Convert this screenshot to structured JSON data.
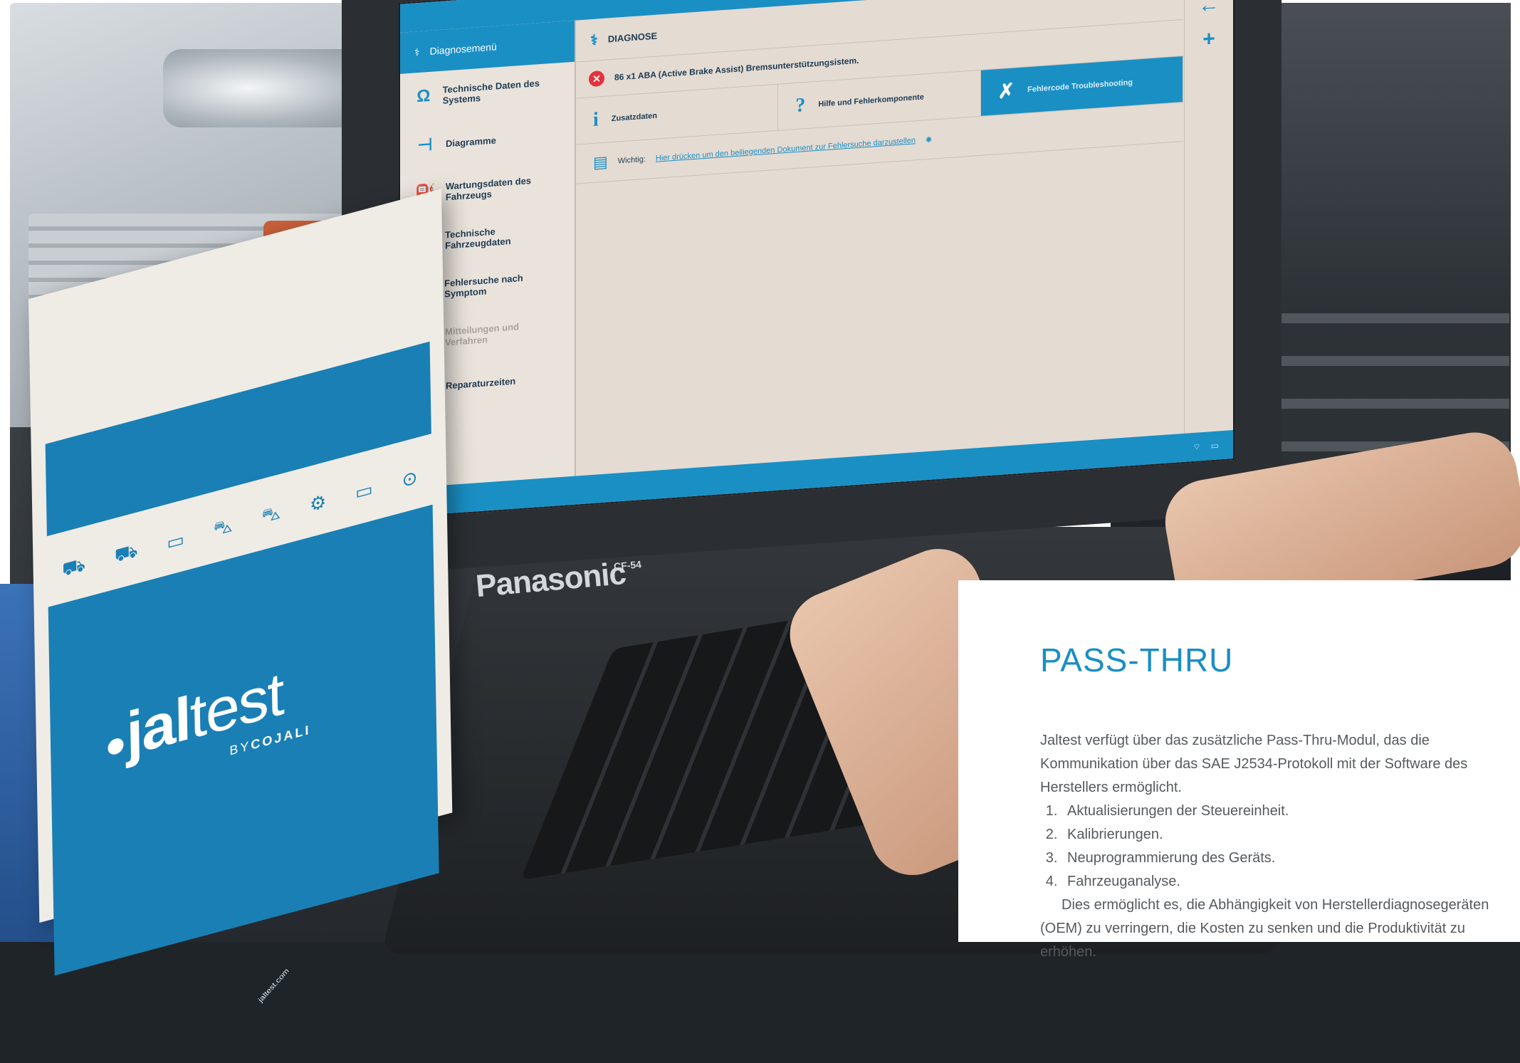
{
  "screen": {
    "menu_header": "Diagnosemenü",
    "menu_items": [
      {
        "label": "Technische Daten des Systems",
        "icon": "omega-icon",
        "disabled": false
      },
      {
        "label": "Diagramme",
        "icon": "diagram-icon",
        "disabled": false
      },
      {
        "label": "Wartungsdaten des Fahrzeugs",
        "icon": "oil-can-icon",
        "disabled": false
      },
      {
        "label": "Technische Fahrzeugdaten",
        "icon": "wrench-icon",
        "disabled": false
      },
      {
        "label": "Fehlersuche nach Symptom",
        "icon": "tools-icon",
        "disabled": false
      },
      {
        "label": "Mitteilungen und Verfahren",
        "icon": "document-icon",
        "disabled": true
      },
      {
        "label": "Reparaturzeiten",
        "icon": "gear-clock-icon",
        "disabled": false
      }
    ],
    "diag_title": "DIAGNOSE",
    "fault_text": "86  x1  ABA (Active Brake Assist) Bremsunterstützungsistem.",
    "tabs": [
      {
        "label": "Zusatzdaten",
        "icon_char": "i",
        "active": false
      },
      {
        "label": "Hilfe und Fehlerkomponente",
        "icon_char": "?",
        "active": false
      },
      {
        "label": "Fehlercode Troubleshooting",
        "icon_char": "✗",
        "active": true
      }
    ],
    "info_label": "Wichtig:",
    "info_link": "Hier drücken um den beiliegenden Dokument zur Fehlersuche darzustellen"
  },
  "laptop": {
    "brand": "Panasonic",
    "model": "CF-54"
  },
  "brochure": {
    "logo_main": "jal",
    "logo_light": "test",
    "by_prefix": "BY",
    "by_brand": "COJALI",
    "url": "jaltest.com"
  },
  "card": {
    "title": "PASS-THRU",
    "intro": "Jaltest verfügt über das zusätzliche Pass-Thru-Modul, das die Kommunikation über das SAE J2534-Protokoll mit der Software des Herstellers ermöglicht.",
    "list": [
      "Aktualisierungen der Steuereinheit.",
      "Kalibrierungen.",
      "Neuprogrammierung des Geräts.",
      "Fahrzeuganalyse."
    ],
    "outro": "Dies ermöglicht es, die Abhängigkeit von Herstellerdiagnosegeräten (OEM) zu verringern, die Kosten zu senken und die Produktivität zu erhöhen."
  },
  "colors": {
    "accent": "#1a8fc4",
    "brochure_blue": "#1a7fb4",
    "error_red": "#e2343b",
    "orange": "#ef7e2e"
  }
}
